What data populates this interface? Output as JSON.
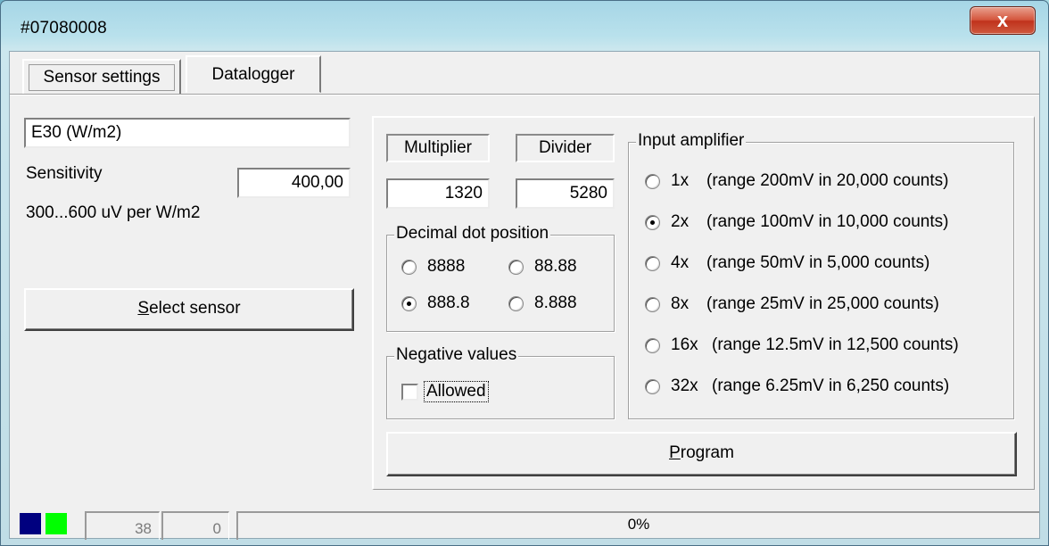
{
  "window": {
    "title": "#07080008",
    "close_glyph": "x"
  },
  "tabs": [
    {
      "label": "Sensor settings",
      "selected": true
    },
    {
      "label": "Datalogger",
      "selected": false
    }
  ],
  "sensor": {
    "name_value": "E30 (W/m2)",
    "sensitivity_label": "Sensitivity",
    "sensitivity_value": "400,00",
    "range_text": "300...600 uV per W/m2",
    "select_button_mnemonic": "S",
    "select_button_rest": "elect sensor"
  },
  "scaling": {
    "multiplier_label": "Multiplier",
    "multiplier_value": "1320",
    "divider_label": "Divider",
    "divider_value": "5280"
  },
  "decimal_dot": {
    "title": "Decimal dot position",
    "options": [
      {
        "label": "8888",
        "checked": false
      },
      {
        "label": "88.88",
        "checked": false
      },
      {
        "label": "888.8",
        "checked": true
      },
      {
        "label": "8.888",
        "checked": false
      }
    ]
  },
  "negative_values": {
    "title": "Negative values",
    "checkbox_label": "Allowed",
    "checked": false
  },
  "input_amplifier": {
    "title": "Input amplifier",
    "options": [
      {
        "gain": "1x",
        "range": "(range 200mV in 20,000 counts)",
        "checked": false
      },
      {
        "gain": "2x",
        "range": "(range 100mV in 10,000 counts)",
        "checked": true
      },
      {
        "gain": "4x",
        "range": "(range 50mV in 5,000 counts)",
        "checked": false
      },
      {
        "gain": "8x",
        "range": "(range 25mV in 25,000 counts)",
        "checked": false
      },
      {
        "gain": "16x",
        "range": "(range 12.5mV in 12,500 counts)",
        "checked": false
      },
      {
        "gain": "32x",
        "range": "(range 6.25mV in 6,250 counts)",
        "checked": false
      }
    ]
  },
  "program_button": {
    "mnemonic": "P",
    "rest": "rogram"
  },
  "status": {
    "swatch_colors": [
      "#00007f",
      "#00ff00"
    ],
    "count_a": "38",
    "count_b": "0",
    "progress_text": "0%",
    "progress_fraction": 0.0
  }
}
